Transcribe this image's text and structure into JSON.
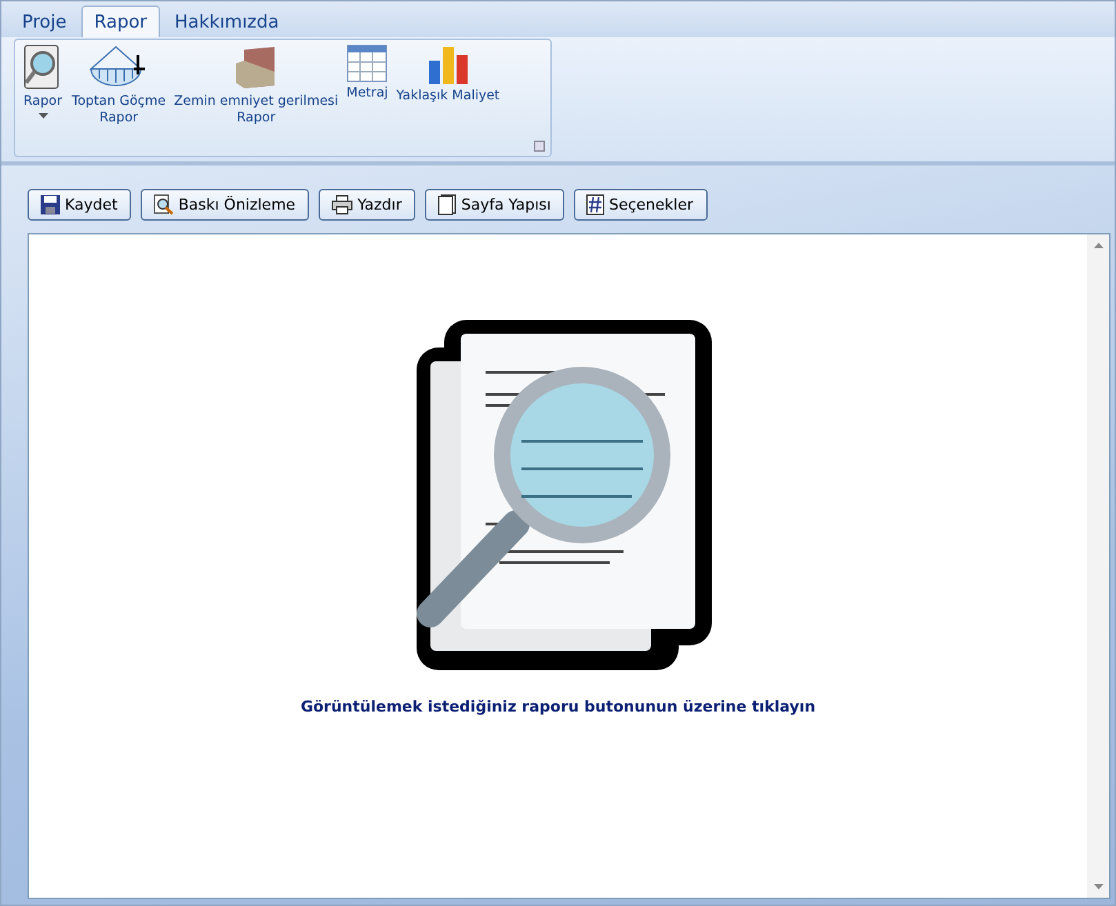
{
  "tabs": [
    {
      "label": "Proje",
      "selected": false
    },
    {
      "label": "Rapor",
      "selected": true
    },
    {
      "label": "Hakkımızda",
      "selected": false
    }
  ],
  "ribbon": {
    "items": [
      {
        "kind": "preview",
        "label": "Rapor",
        "dropdown": true
      },
      {
        "kind": "dome",
        "label": "Toptan Göçme\nRapor",
        "dropdown": false
      },
      {
        "kind": "soil",
        "label": "Zemin emniyet gerilmesi\nRapor",
        "dropdown": false
      },
      {
        "kind": "table",
        "label": "Metraj",
        "dropdown": false
      },
      {
        "kind": "chart",
        "label": "Yaklaşık Maliyet",
        "dropdown": false
      }
    ]
  },
  "toolbar": [
    {
      "kind": "save",
      "label": "Kaydet"
    },
    {
      "kind": "preview",
      "label": "Baskı Önizleme"
    },
    {
      "kind": "print",
      "label": "Yazdır"
    },
    {
      "kind": "page",
      "label": "Sayfa Yapısı"
    },
    {
      "kind": "options",
      "label": "Seçenekler"
    }
  ],
  "report": {
    "message": "Görüntülemek istediğiniz raporu butonunun üzerine tıklayın"
  }
}
